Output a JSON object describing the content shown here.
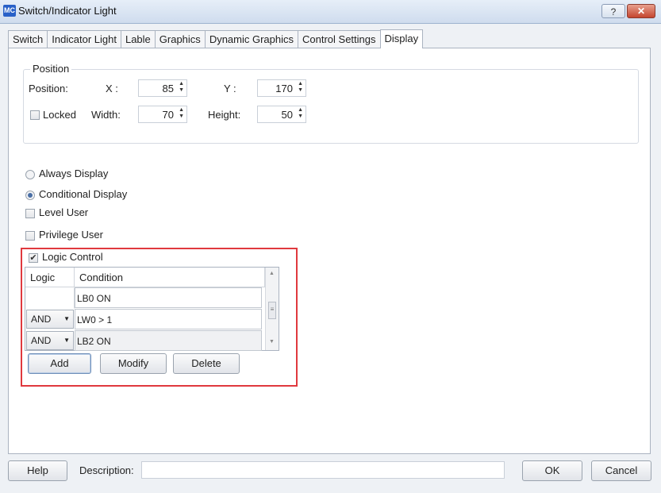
{
  "window": {
    "title": "Switch/Indicator Light",
    "app_icon": "MC",
    "help_button": "?",
    "close_button": "✕"
  },
  "tabs": [
    {
      "label": "Switch"
    },
    {
      "label": "Indicator Light"
    },
    {
      "label": "Lable"
    },
    {
      "label": "Graphics"
    },
    {
      "label": "Dynamic Graphics"
    },
    {
      "label": "Control Settings"
    },
    {
      "label": "Display",
      "active": true
    }
  ],
  "position": {
    "group_title": "Position",
    "position_label": "Position:",
    "x_label": "X :",
    "x_value": "85",
    "y_label": "Y :",
    "y_value": "170",
    "locked_label": "Locked",
    "locked_checked": false,
    "width_label": "Width:",
    "width_value": "70",
    "height_label": "Height:",
    "height_value": "50"
  },
  "display": {
    "always_display": "Always Display",
    "conditional_display": "Conditional Display",
    "selected": "conditional",
    "level_user": "Level User",
    "privilege_user": "Privilege User",
    "logic_control": "Logic Control",
    "logic_control_checked": true
  },
  "condition_table": {
    "headers": {
      "logic": "Logic",
      "condition": "Condition"
    },
    "rows": [
      {
        "logic": "",
        "condition": "LB0 ON"
      },
      {
        "logic": "AND",
        "condition": "LW0 > 1"
      },
      {
        "logic": "AND",
        "condition": "LB2 ON"
      }
    ]
  },
  "table_buttons": {
    "add": "Add",
    "modify": "Modify",
    "delete": "Delete"
  },
  "footer": {
    "help": "Help",
    "description_label": "Description:",
    "description_value": "",
    "ok": "OK",
    "cancel": "Cancel"
  },
  "colors": {
    "highlight_box": "#e0393e",
    "title_bar": "#cfdcee",
    "close_button": "#c4452f"
  },
  "icons": {
    "spinner": "spin-arrows-icon",
    "dropdown": "chevron-down-icon",
    "check": "checkmark-icon"
  }
}
